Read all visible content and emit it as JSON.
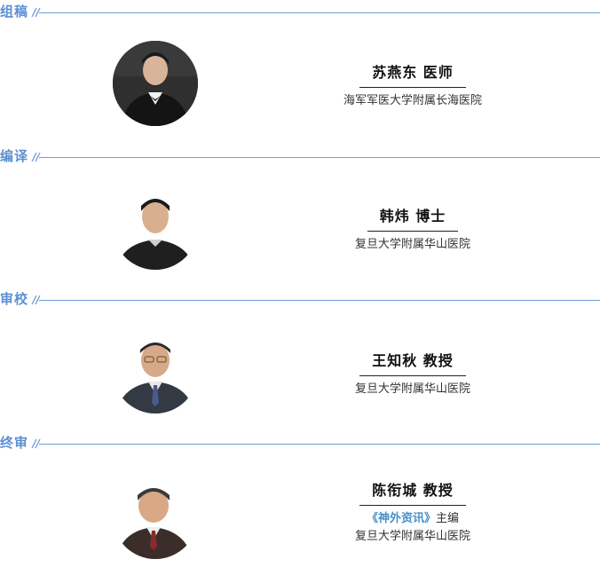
{
  "sections": [
    {
      "title": "组稿",
      "person": {
        "name": "苏燕东 医师",
        "lines": [
          "海军军医大学附属长海医院"
        ]
      }
    },
    {
      "title": "编译",
      "person": {
        "name": "韩炜 博士",
        "lines": [
          "复旦大学附属华山医院"
        ]
      }
    },
    {
      "title": "审校",
      "person": {
        "name": "王知秋 教授",
        "lines": [
          "复旦大学附属华山医院"
        ]
      }
    },
    {
      "title": "终审",
      "person": {
        "name": "陈衔城 教授",
        "journal": "《神外资讯》",
        "role": "主编",
        "lines": [
          "复旦大学附属华山医院"
        ]
      }
    }
  ],
  "colors": {
    "accent": "#5b8fd3",
    "rule": "#6d9edb",
    "journal": "#4a90c8"
  }
}
